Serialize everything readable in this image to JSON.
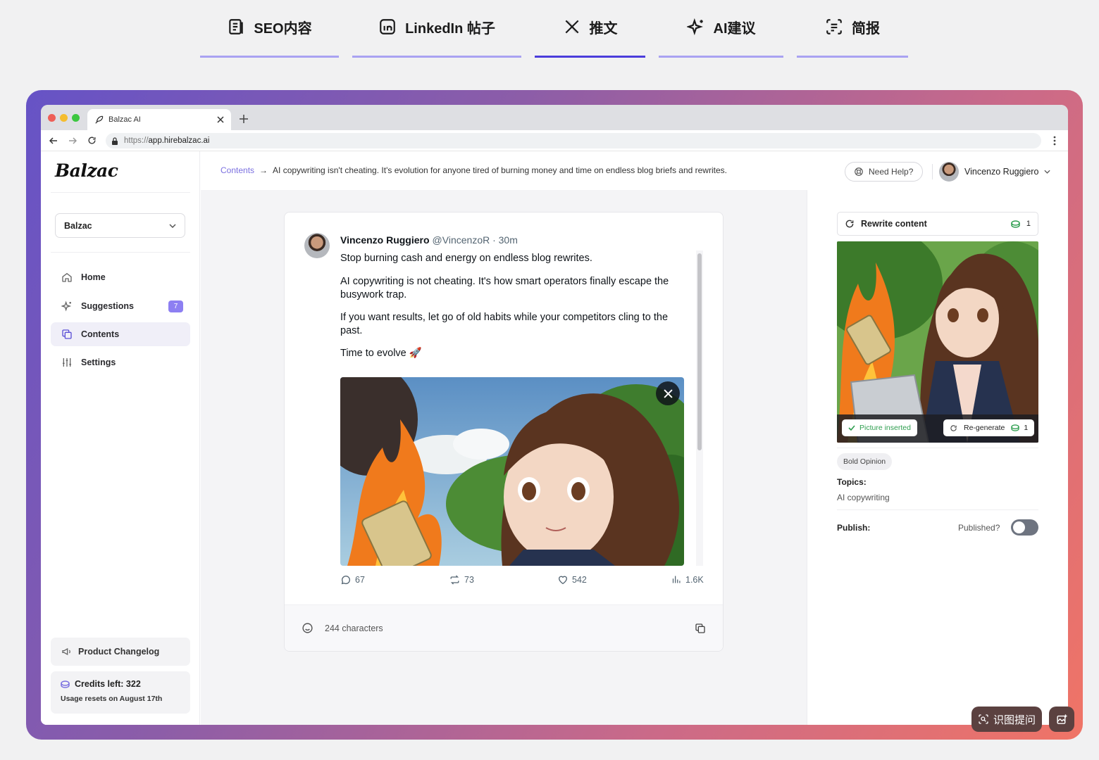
{
  "top_tabs": [
    {
      "label": "SEO内容",
      "icon": "document-icon"
    },
    {
      "label": "LinkedIn 帖子",
      "icon": "linkedin-icon"
    },
    {
      "label": "推文",
      "icon": "x-logo-icon",
      "active": true
    },
    {
      "label": "AI建议",
      "icon": "sparkles-icon"
    },
    {
      "label": "简报",
      "icon": "scan-text-icon"
    }
  ],
  "browser": {
    "tab_title": "Balzac AI",
    "url_prefix": "https://",
    "url_host": "app.hirebalzac.ai"
  },
  "sidebar": {
    "logo": "Balzac",
    "workspace": "Balzac",
    "nav": [
      {
        "label": "Home",
        "icon": "home-icon"
      },
      {
        "label": "Suggestions",
        "icon": "sparkles-icon",
        "badge": "7"
      },
      {
        "label": "Contents",
        "icon": "copy-icon",
        "active": true
      },
      {
        "label": "Settings",
        "icon": "sliders-icon"
      }
    ],
    "changelog": "Product Changelog",
    "credits": "Credits left: 322",
    "usage_reset": "Usage resets on August 17th"
  },
  "header": {
    "breadcrumb_root": "Contents",
    "breadcrumb_arrow": "→",
    "breadcrumb_title": "AI copywriting isn't cheating. It's evolution for anyone tired of burning money and time on endless blog briefs and rewrites.",
    "help": "Need Help?",
    "user_name": "Vincenzo Ruggiero"
  },
  "tweet": {
    "author": "Vincenzo Ruggiero",
    "handle": "@VincenzoR · 30m",
    "paragraphs": [
      "Stop burning cash and energy on endless blog rewrites.",
      "AI copywriting is not cheating. It's how smart operators finally escape the busywork trap.",
      "If you want results, let go of old habits while your competitors cling to the past.",
      "Time to evolve 🚀"
    ],
    "replies": "67",
    "retweets": "73",
    "likes": "542",
    "views": "1.6K",
    "char_count": "244 characters"
  },
  "right_panel": {
    "rewrite": "Rewrite content",
    "rewrite_cost": "1",
    "picture_inserted": "Picture inserted",
    "regenerate": "Re-generate",
    "regenerate_cost": "1",
    "tag": "Bold Opinion",
    "topics_label": "Topics:",
    "topics_value": "AI copywriting",
    "publish_label": "Publish:",
    "published_label": "Published?",
    "published": false
  },
  "floating": {
    "ask_image": "识图提问"
  },
  "colors": {
    "accent": "#4b3ddb",
    "accent_light": "#a9a2f2",
    "badge": "#8d7ff2",
    "green": "#2e9e4f"
  }
}
